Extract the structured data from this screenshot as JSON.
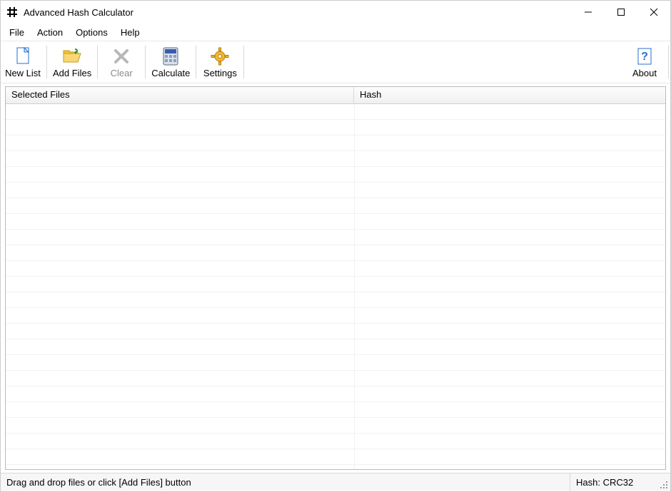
{
  "window": {
    "title": "Advanced Hash Calculator"
  },
  "menubar": {
    "file": "File",
    "action": "Action",
    "options": "Options",
    "help": "Help"
  },
  "toolbar": {
    "new_list": "New List",
    "add_files": "Add Files",
    "clear": "Clear",
    "calculate": "Calculate",
    "settings": "Settings",
    "about": "About"
  },
  "table": {
    "col_files": "Selected Files",
    "col_hash": "Hash",
    "rows": []
  },
  "statusbar": {
    "hint": "Drag and drop files or click [Add Files] button",
    "hash_label": "Hash: CRC32"
  }
}
